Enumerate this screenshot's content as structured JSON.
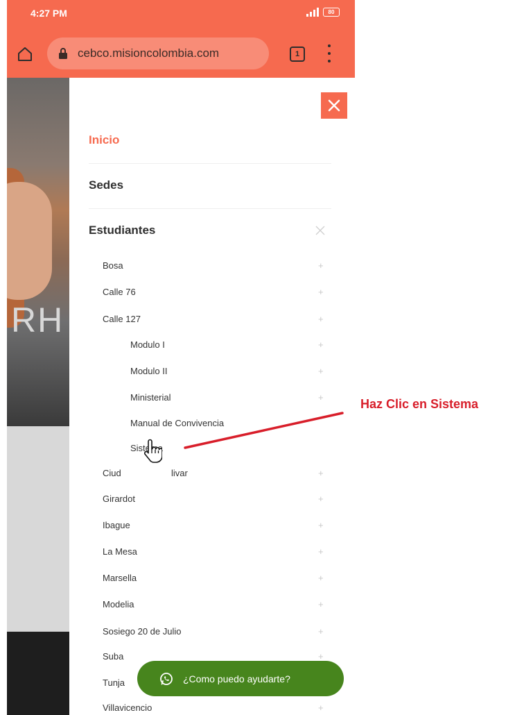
{
  "status_bar": {
    "time": "4:27 PM",
    "battery": "80"
  },
  "browser": {
    "url": "cebco.misioncolombia.com",
    "tab_count": "1"
  },
  "background": {
    "hero_text": "RH"
  },
  "nav": {
    "top_items": [
      {
        "label": "Inicio"
      },
      {
        "label": "Sedes"
      },
      {
        "label": "Estudiantes"
      }
    ],
    "sub_items": [
      {
        "label": "Bosa"
      },
      {
        "label": "Calle 76"
      },
      {
        "label": "Calle 127"
      },
      {
        "label": "Modulo I"
      },
      {
        "label": "Modulo II"
      },
      {
        "label": "Ministerial"
      },
      {
        "label": "Manual de Convivencia"
      },
      {
        "label": "Sistema"
      },
      {
        "label": "Ciud",
        "label_tail": "livar"
      },
      {
        "label": "Girardot"
      },
      {
        "label": "Ibague"
      },
      {
        "label": "La Mesa"
      },
      {
        "label": "Marsella"
      },
      {
        "label": "Modelia"
      },
      {
        "label": "Sosiego 20 de Julio"
      },
      {
        "label": "Suba"
      },
      {
        "label": "Tunja"
      },
      {
        "label": "Villavicencio"
      }
    ]
  },
  "whatsapp": {
    "label": "¿Como puedo ayudarte?"
  },
  "annotation": {
    "text": "Haz Clic en Sistema"
  },
  "colors": {
    "brand": "#f66a4f",
    "whatsapp": "#47851d",
    "annotation": "#d81e2a"
  },
  "icons": [
    "home-icon",
    "lock-icon",
    "tab-count-icon",
    "menu-dots-icon",
    "close-icon",
    "plus-icon",
    "x-icon",
    "hand-cursor-icon",
    "whatsapp-icon",
    "signal-icon",
    "battery-icon"
  ]
}
